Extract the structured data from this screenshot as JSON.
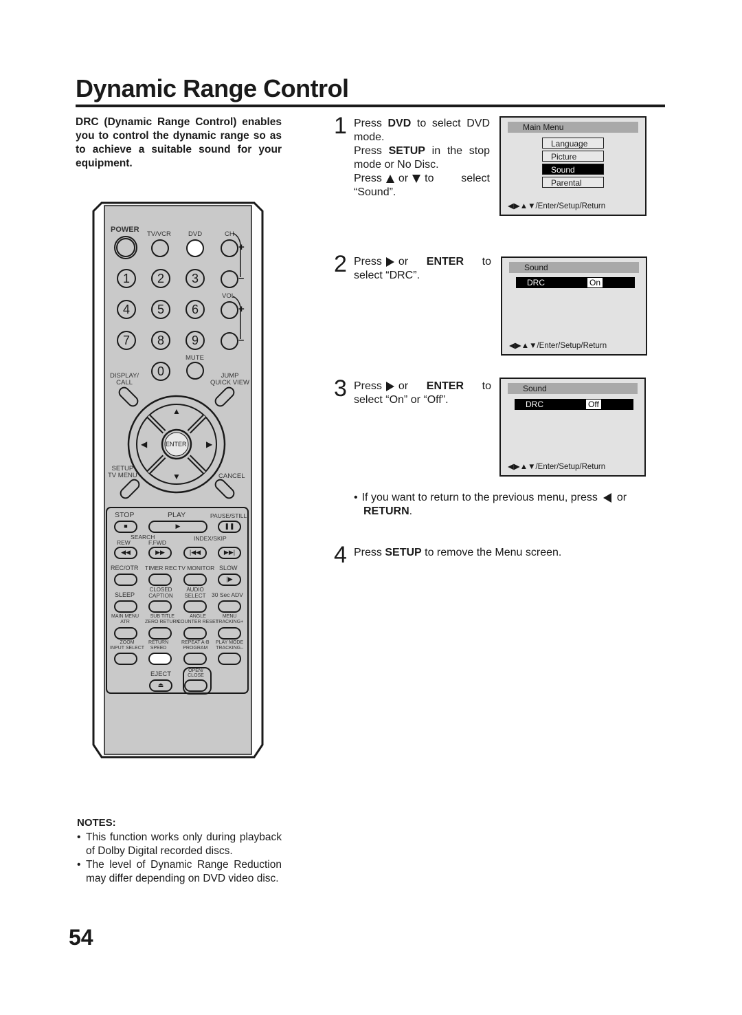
{
  "page": {
    "title": "Dynamic Range Control",
    "page_number": "54"
  },
  "intro": "DRC (Dynamic Range Control) enables you to control the dynamic range so as to achieve a suitable sound for your equipment.",
  "steps": [
    {
      "number": "1",
      "line1_pre": "Press ",
      "line1_bold": "DVD",
      "line1_post": " to select DVD mode.",
      "line2_pre": "Press ",
      "line2_bold": "SETUP",
      "line2_post": " in the stop mode or No Disc.",
      "line3_pre": "Press",
      "line3_mid": "or",
      "line3_post": "to select “Sound”."
    },
    {
      "number": "2",
      "pre": "Press",
      "mid": "or ",
      "bold": "ENTER",
      "post": " to select “DRC”."
    },
    {
      "number": "3",
      "pre": "Press",
      "mid": "or ",
      "bold": "ENTER",
      "post": " to select “On” or “Off”."
    },
    {
      "number": "4",
      "pre": "Press ",
      "bold": "SETUP",
      "post": " to remove the Menu screen."
    }
  ],
  "return_note": {
    "pre": "If you want to return to the previous menu, press",
    "mid": "or",
    "bold": "RETURN",
    "post": "."
  },
  "osd_main_menu": {
    "header": "Main Menu",
    "items": [
      {
        "label": "Language",
        "selected": false
      },
      {
        "label": "Picture",
        "selected": false
      },
      {
        "label": "Sound",
        "selected": true
      },
      {
        "label": "Parental",
        "selected": false
      }
    ],
    "footer": "◀▶▲▼/Enter/Setup/Return"
  },
  "osd_sound_on": {
    "header": "Sound",
    "row_label": "DRC",
    "row_value": "On",
    "footer": "◀▶▲▼/Enter/Setup/Return"
  },
  "osd_sound_off": {
    "header": "Sound",
    "row_label": "DRC",
    "row_value": "Off",
    "footer": "◀▶▲▼/Enter/Setup/Return"
  },
  "remote": {
    "power": "POWER",
    "tv_vcr": "TV/VCR",
    "dvd": "DVD",
    "ch": "CH",
    "vol": "VOL",
    "mute": "MUTE",
    "plus": "+",
    "minus": "–",
    "digits": [
      "1",
      "2",
      "3",
      "4",
      "5",
      "6",
      "7",
      "8",
      "9",
      "0"
    ],
    "display_call": [
      "DISPLAY/",
      "CALL"
    ],
    "jump_quickview": [
      "JUMP",
      "QUICK VIEW"
    ],
    "enter": "ENTER",
    "setup_tvmenu": [
      "SETUP",
      "TV MENU"
    ],
    "cancel": "CANCEL",
    "stop": "STOP",
    "play": "PLAY",
    "pause_still": "PAUSE/STILL",
    "search": "SEARCH",
    "rew": "REW",
    "ffwd": "F.FWD",
    "index_skip": "INDEX/SKIP",
    "row_labels_1": [
      "REC/OTR",
      "TIMER REC",
      "TV MONITOR",
      "SLOW"
    ],
    "row_labels_2": [
      "SLEEP",
      "CLOSED CAPTION",
      "AUDIO SELECT",
      "30 Sec ADV"
    ],
    "row_labels_3a": [
      "MAIN MENU",
      "SUB TITLE",
      "ANGLE",
      "MENU"
    ],
    "row_labels_3b": [
      "ATR",
      "ZERO RETURN",
      "COUNTER RESET",
      "TRACKING+"
    ],
    "row_labels_4a": [
      "ZOOM",
      "RETURN",
      "REPEAT A-B",
      "PLAY MODE"
    ],
    "row_labels_4b": [
      "INPUT SELECT",
      "SPEED",
      "PROGRAM",
      "TRACKING–"
    ],
    "eject": "EJECT",
    "open_close": "OPEN/ CLOSE",
    "glyphs": {
      "stop": "■",
      "play": "▶",
      "pause": "❚❚",
      "rew": "◀◀",
      "ffwd": "▶▶",
      "prev": "|◀◀",
      "next": "▶▶|",
      "slow": "|▶",
      "eject": "⏏",
      "up": "▲",
      "down": "▼",
      "left": "◀",
      "right": "▶"
    },
    "highlighted_buttons": [
      "DVD",
      "RETURN"
    ]
  },
  "notes": {
    "heading": "NOTES:",
    "items": [
      "This function works only during playback of Dolby Digital recorded discs.",
      "The level of Dynamic Range Reduction may differ depending on DVD video disc."
    ]
  }
}
